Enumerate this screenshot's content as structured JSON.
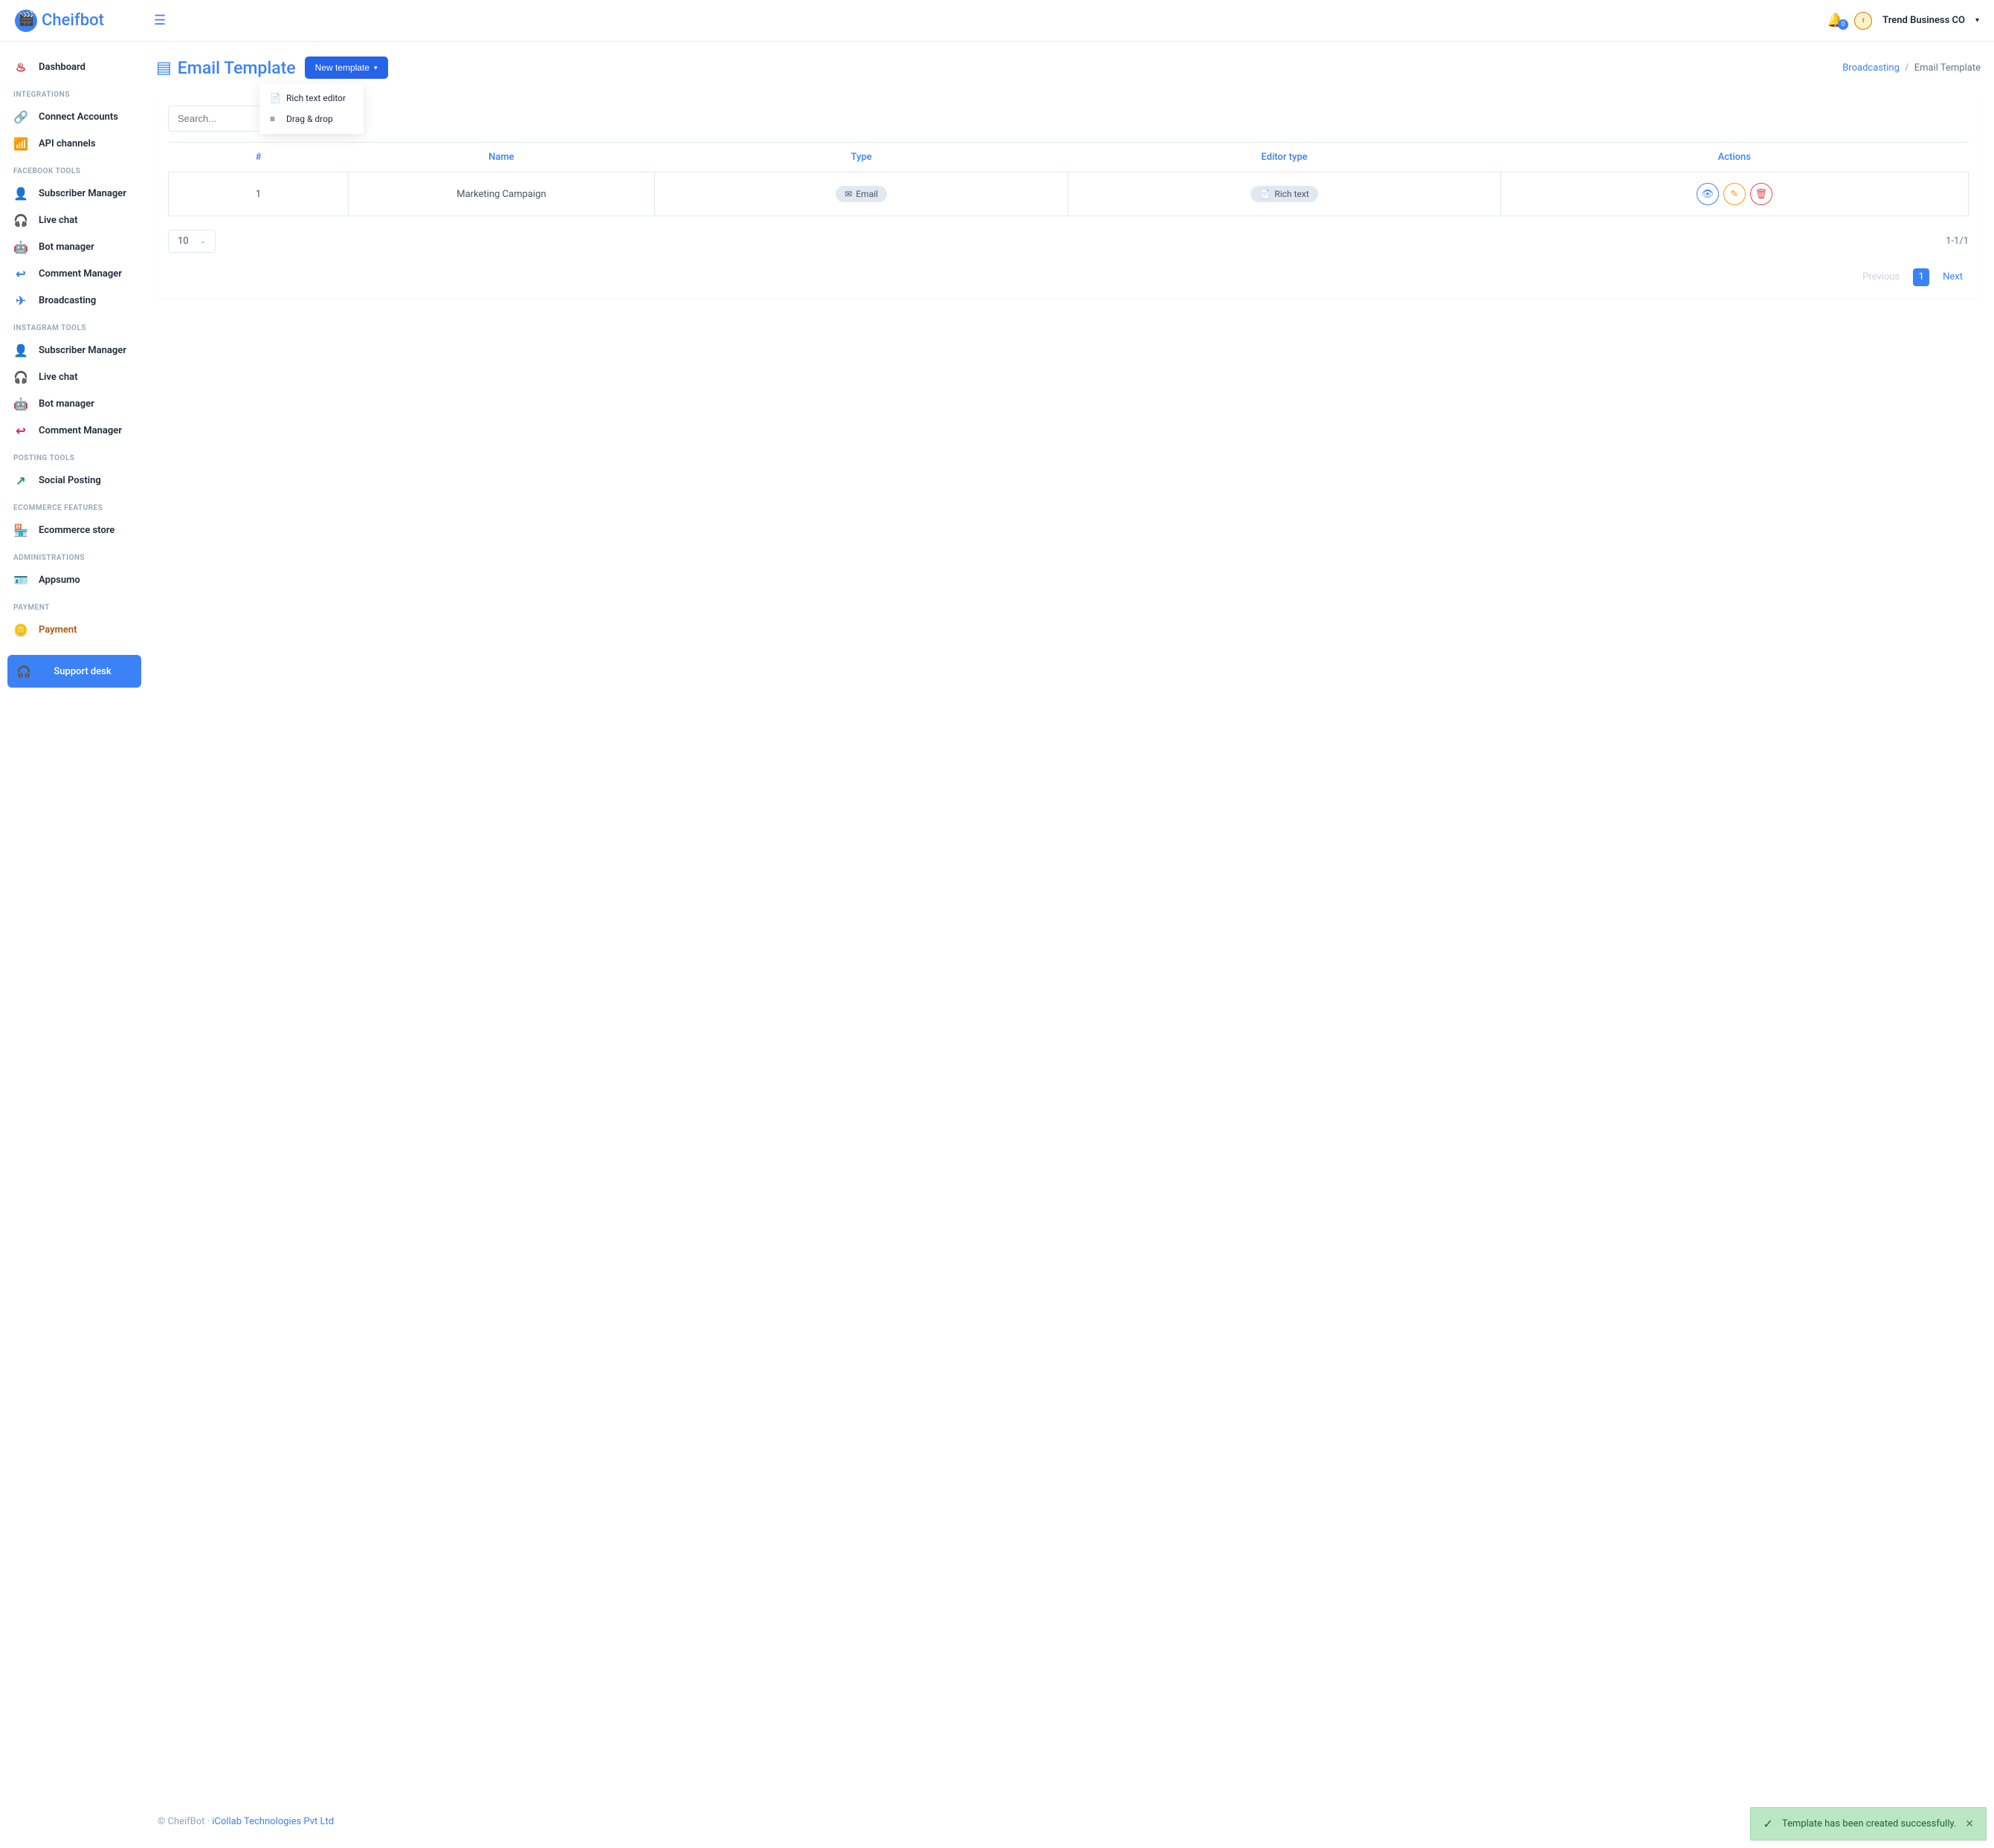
{
  "header": {
    "brand": "Cheifbot",
    "notif_count": "0",
    "user_name": "Trend Business CO"
  },
  "sidebar": {
    "dashboard": "Dashboard",
    "sec_integrations": "INTEGRATIONS",
    "connect_accounts": "Connect Accounts",
    "api_channels": "API channels",
    "sec_facebook": "FACEBOOK TOOLS",
    "fb_sub": "Subscriber Manager",
    "fb_live": "Live chat",
    "fb_bot": "Bot manager",
    "fb_comment": "Comment Manager",
    "fb_broadcast": "Broadcasting",
    "sec_instagram": "INSTAGRAM TOOLS",
    "ig_sub": "Subscriber Manager",
    "ig_live": "Live chat",
    "ig_bot": "Bot manager",
    "ig_comment": "Comment Manager",
    "sec_posting": "POSTING TOOLS",
    "social_posting": "Social Posting",
    "sec_ecom": "ECOMMERCE FEATURES",
    "ecom_store": "Ecommerce store",
    "sec_admin": "ADMINISTRATIONS",
    "appsumo": "Appsumo",
    "sec_payment": "PAYMENT",
    "payment": "Payment",
    "support": "Support desk"
  },
  "page": {
    "title": "Email Template",
    "new_btn": "New template",
    "dd_rich": "Rich text editor",
    "dd_drag": "Drag & drop",
    "bc_broadcasting": "Broadcasting",
    "bc_current": "Email Template"
  },
  "table": {
    "search_placeholder": "Search...",
    "col_hash": "#",
    "col_name": "Name",
    "col_type": "Type",
    "col_editor": "Editor type",
    "col_actions": "Actions",
    "row1_num": "1",
    "row1_name": "Marketing Campaign",
    "row1_type": "Email",
    "row1_editor": "Rich text",
    "page_size": "10",
    "count": "1-1/1",
    "prev": "Previous",
    "cur": "1",
    "next": "Next"
  },
  "footer": {
    "copyright": "© CheifBot",
    "sep": " · ",
    "company": "iCollab Technologies Pvt Ltd"
  },
  "toast": {
    "message": "Template has been created successfully."
  }
}
